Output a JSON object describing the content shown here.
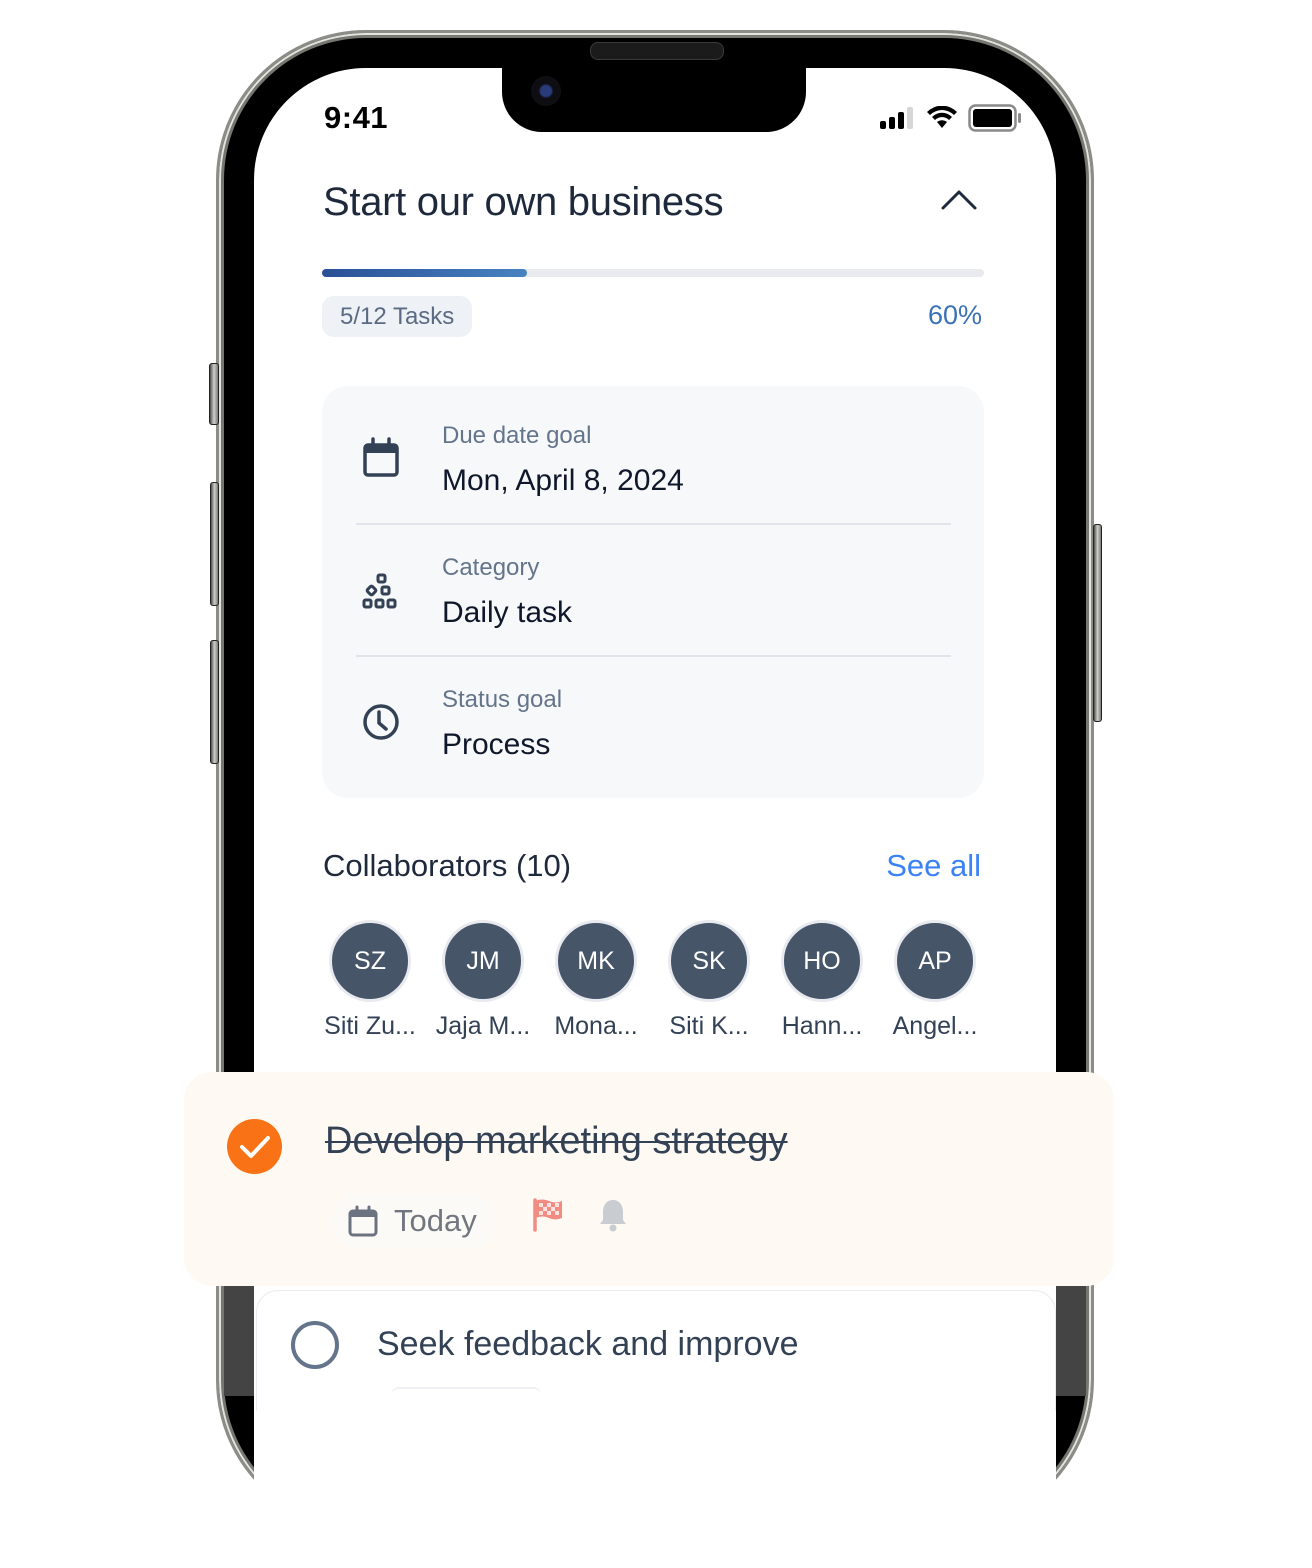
{
  "status_bar": {
    "time": "9:41",
    "icons": [
      "cellular-signal-icon",
      "wifi-icon",
      "battery-icon"
    ]
  },
  "goal": {
    "title": "Start our own business",
    "collapse_icon": "chevron-up-icon",
    "progress_percent": 31,
    "tasks_label": "5/12  Tasks",
    "percent_label": "60%"
  },
  "details": [
    {
      "icon": "calendar-icon",
      "label": "Due date goal",
      "value": "Mon, April 8, 2024"
    },
    {
      "icon": "category-blocks-icon",
      "label": "Category",
      "value": "Daily task"
    },
    {
      "icon": "clock-icon",
      "label": "Status goal",
      "value": "Process"
    }
  ],
  "collaborators": {
    "title": "Collaborators (10)",
    "see_all": "See all",
    "people": [
      {
        "initials": "SZ",
        "name": "Siti Zu..."
      },
      {
        "initials": "JM",
        "name": "Jaja M..."
      },
      {
        "initials": "MK",
        "name": "Mona..."
      },
      {
        "initials": "SK",
        "name": "Siti K..."
      },
      {
        "initials": "HO",
        "name": "Hann..."
      },
      {
        "initials": "AP",
        "name": "Angel..."
      }
    ]
  },
  "tasks": [
    {
      "title": "Develop marketing strategy",
      "completed": true,
      "due_label": "Today",
      "icons": [
        "calendar-icon",
        "checkered-flag-icon",
        "bell-icon"
      ]
    },
    {
      "title": "Seek feedback and improve",
      "completed": false
    }
  ],
  "colors": {
    "accent_blue": "#3b82f6",
    "progress_blue": "#2a4f96",
    "check_orange": "#f97316",
    "avatar_bg": "#475569",
    "flag_red": "#f28b82"
  }
}
